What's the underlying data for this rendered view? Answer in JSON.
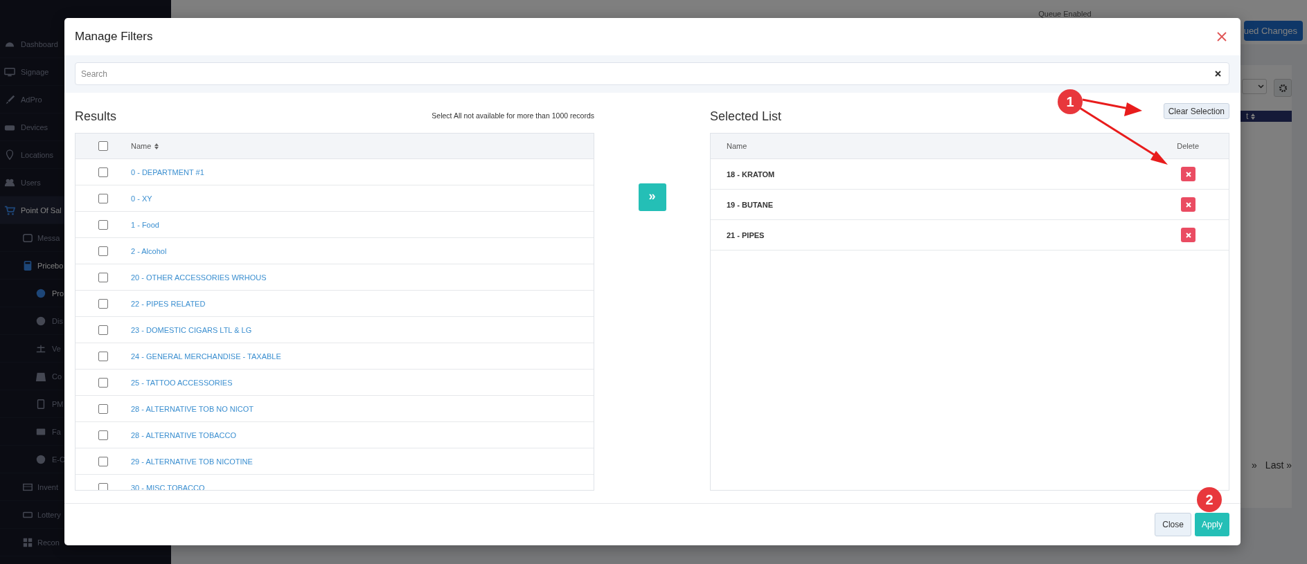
{
  "background": {
    "queue_label": "Queue Enabled",
    "queue_button": "ued Changes",
    "table_header": "t",
    "pagination": [
      "»",
      "Last »"
    ]
  },
  "sidebar": {
    "items": [
      {
        "label": "Dashboard",
        "selected": false
      },
      {
        "label": "Signage",
        "selected": false
      },
      {
        "label": "AdPro",
        "selected": false
      },
      {
        "label": "Devices",
        "selected": false
      },
      {
        "label": "Locations",
        "selected": false
      },
      {
        "label": "Users",
        "selected": false
      },
      {
        "label": "Point Of Sal",
        "selected": true,
        "children": [
          {
            "label": "Messa",
            "selected": false
          },
          {
            "label": "Pricebo",
            "selected": true,
            "children": [
              {
                "label": "Pro",
                "selected": true
              },
              {
                "label": "Dis",
                "selected": false
              },
              {
                "label": "Ve",
                "selected": false
              },
              {
                "label": "Co",
                "selected": false
              },
              {
                "label": "PM",
                "selected": false
              },
              {
                "label": "Fa",
                "selected": false
              },
              {
                "label": "E-C",
                "selected": false
              }
            ]
          },
          {
            "label": "Invent",
            "selected": false
          },
          {
            "label": "Lottery",
            "selected": false
          },
          {
            "label": "Recon",
            "selected": false
          }
        ]
      }
    ]
  },
  "modal": {
    "title": "Manage Filters",
    "search": {
      "placeholder": "Search"
    },
    "results": {
      "title": "Results",
      "note": "Select All not available for more than 1000 records",
      "select_all": {
        "checked": false
      },
      "columns": [
        "Name"
      ],
      "rows": [
        {
          "name": "0 - DEPARTMENT #1",
          "checked": false
        },
        {
          "name": "0 - XY",
          "checked": false
        },
        {
          "name": "1 - Food",
          "checked": false
        },
        {
          "name": "2 - Alcohol",
          "checked": false
        },
        {
          "name": "20 - OTHER ACCESSORIES WRHOUS",
          "checked": false
        },
        {
          "name": "22 - PIPES RELATED",
          "checked": false
        },
        {
          "name": "23 - DOMESTIC CIGARS LTL & LG",
          "checked": false
        },
        {
          "name": "24 - GENERAL MERCHANDISE - TAXABLE",
          "checked": false
        },
        {
          "name": "25 - TATTOO ACCESSORIES",
          "checked": false
        },
        {
          "name": "28 - ALTERNATIVE TOB NO NICOT",
          "checked": false
        },
        {
          "name": "28 - ALTERNATIVE TOBACCO",
          "checked": false
        },
        {
          "name": "29 - ALTERNATIVE TOB NICOTINE",
          "checked": false
        },
        {
          "name": "30 - MISC TOBACCO",
          "checked": false
        }
      ]
    },
    "move_button": "»",
    "selected_list": {
      "title": "Selected List",
      "clear_button": "Clear Selection",
      "columns": [
        "Name",
        "Delete"
      ],
      "rows": [
        {
          "name": "18 - KRATOM"
        },
        {
          "name": "19 - BUTANE"
        },
        {
          "name": "21 - PIPES"
        }
      ]
    },
    "buttons": [
      "Close",
      "Apply"
    ],
    "annotations": [
      {
        "label": "1"
      },
      {
        "label": "2"
      }
    ]
  }
}
